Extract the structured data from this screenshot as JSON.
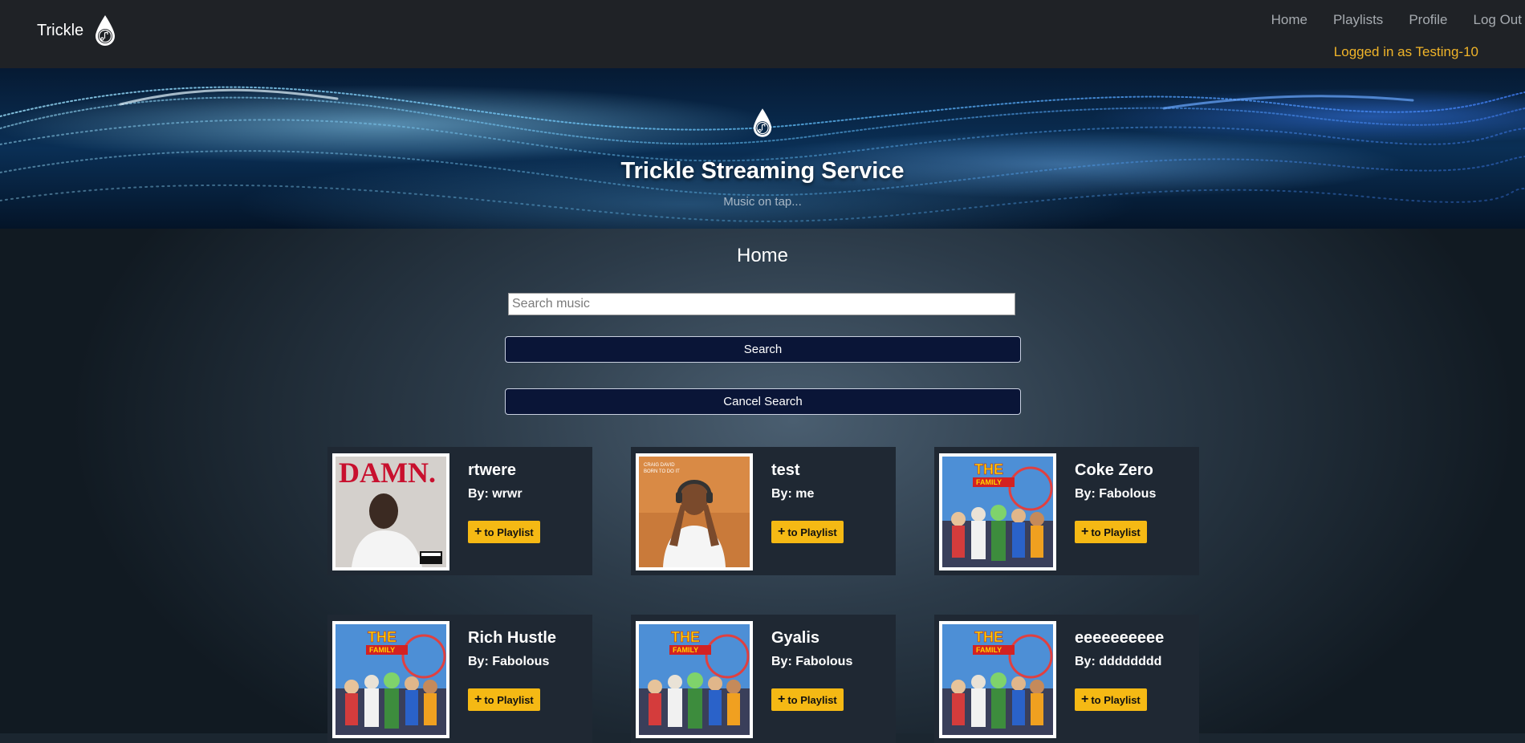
{
  "navbar": {
    "brand": "Trickle",
    "links": [
      "Home",
      "Playlists",
      "Profile",
      "Log Out"
    ],
    "logged_in": "Logged in as Testing-10"
  },
  "hero": {
    "title": "Trickle Streaming Service",
    "subtitle": "Music on tap..."
  },
  "main": {
    "heading": "Home",
    "search_placeholder": "Search music",
    "search_value": "",
    "search_button": "Search",
    "cancel_button": "Cancel Search"
  },
  "songs": [
    {
      "title": "rtwere",
      "artist": "By: wrwr",
      "button": "to Playlist",
      "cover": "damn"
    },
    {
      "title": "test",
      "artist": "By: me",
      "button": "to Playlist",
      "cover": "headphones"
    },
    {
      "title": "Coke Zero",
      "artist": "By: Fabolous",
      "button": "to Playlist",
      "cover": "family"
    },
    {
      "title": "Rich Hustle",
      "artist": "By: Fabolous",
      "button": "to Playlist",
      "cover": "family"
    },
    {
      "title": "Gyalis",
      "artist": "By: Fabolous",
      "button": "to Playlist",
      "cover": "family"
    },
    {
      "title": "eeeeeeeeee",
      "artist": "By: dddddddd",
      "button": "to Playlist",
      "cover": "family"
    }
  ],
  "covers": {
    "damn": {
      "text": "DAMN.",
      "label": "PARENTAL ADVISORY EXPLICIT CONTENT"
    },
    "headphones": {
      "text": "CRAIG DAVID BORN TO DO IT"
    },
    "family": {
      "text": "THE FAMILY"
    }
  },
  "colors": {
    "navbar_bg": "#1f2226",
    "accent_yellow": "#f5b914",
    "logged_in_text": "#f0b429",
    "button_navy": "#0a1537"
  }
}
